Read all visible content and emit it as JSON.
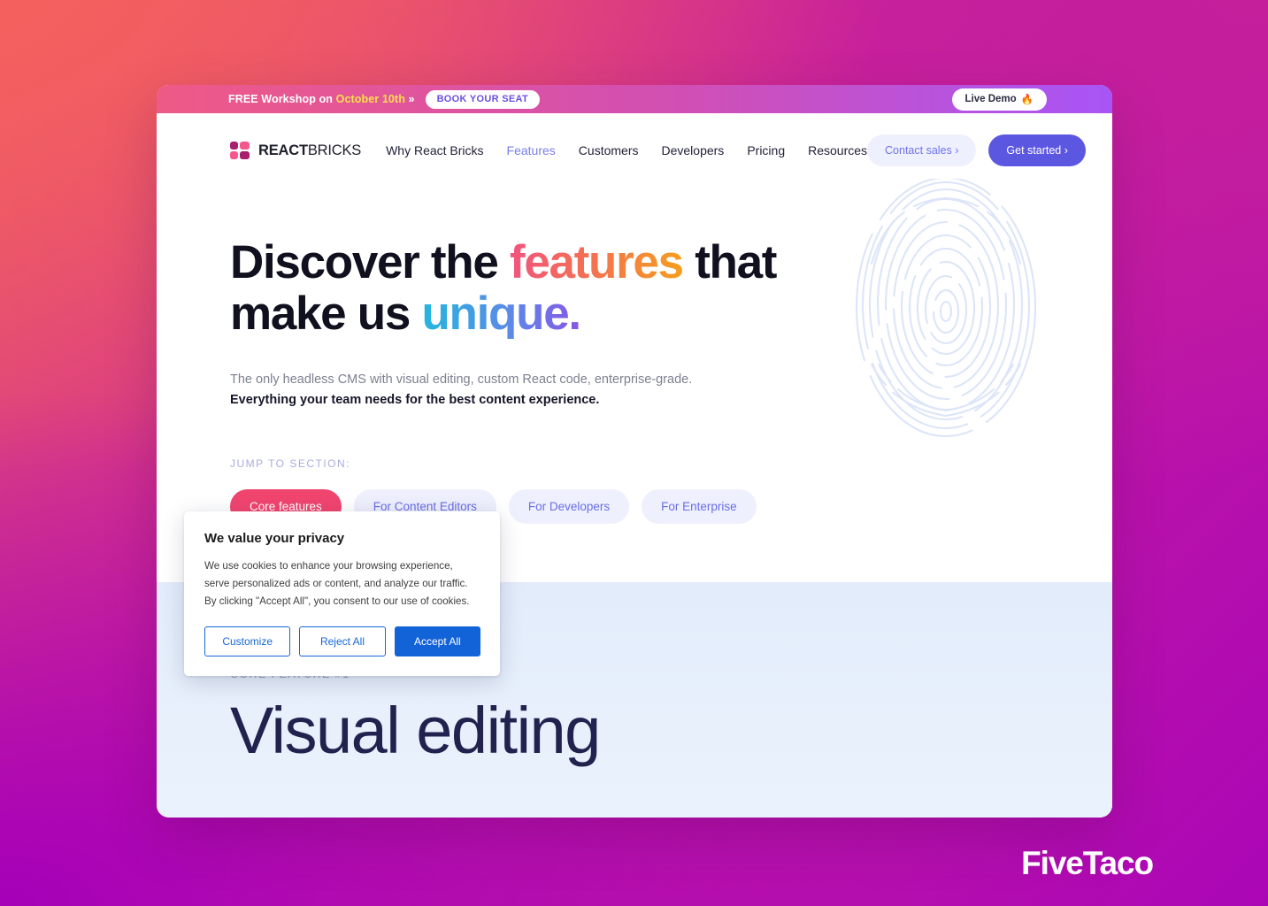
{
  "promo": {
    "text_prefix": "FREE Workshop on ",
    "date": "October 10th",
    "chevron": " »",
    "cta_label": "BOOK YOUR SEAT",
    "live_demo_label": "Live Demo",
    "live_demo_icon": "fire-emoji",
    "live_demo_emoji": "🔥"
  },
  "nav": {
    "brand_bold": "REACT",
    "brand_light": "BRICKS",
    "links": [
      {
        "label": "Why React Bricks",
        "active": false
      },
      {
        "label": "Features",
        "active": true
      },
      {
        "label": "Customers",
        "active": false
      },
      {
        "label": "Developers",
        "active": false
      },
      {
        "label": "Pricing",
        "active": false
      },
      {
        "label": "Resources",
        "active": false
      }
    ],
    "contact_label": "Contact sales ›",
    "get_started_label": "Get started ›"
  },
  "hero": {
    "headline_part1": "Discover the ",
    "headline_accent1": "features",
    "headline_part2": " that",
    "headline_part3": "make us ",
    "headline_accent2": "unique.",
    "sub_line1": "The only headless CMS with visual editing, custom React code, enterprise-grade.",
    "sub_line2": "Everything your team needs for the best content experience.",
    "jump_label": "JUMP TO SECTION:",
    "pills": [
      {
        "label": "Core features",
        "active": true
      },
      {
        "label": "For Content Editors",
        "active": false
      },
      {
        "label": "For Developers",
        "active": false
      },
      {
        "label": "For Enterprise",
        "active": false
      }
    ],
    "art_icon": "fingerprint-illustration"
  },
  "feature_section": {
    "kicker": "CORE FEATURE #1",
    "title": "Visual editing"
  },
  "cookie_dialog": {
    "title": "We value your privacy",
    "body": "We use cookies to enhance your browsing experience, serve personalized ads or content, and analyze our traffic. By clicking \"Accept All\", you consent to our use of cookies.",
    "customize_label": "Customize",
    "reject_label": "Reject All",
    "accept_label": "Accept All"
  },
  "watermark": {
    "text": "FiveTaco"
  },
  "colors": {
    "accent_pink": "#f0456f",
    "accent_purple": "#5c57e0",
    "accent_indigo": "#6a6ee6",
    "cookie_blue": "#1263d8",
    "promo_yellow": "#fbe14a",
    "feature_navy": "#22224f"
  }
}
